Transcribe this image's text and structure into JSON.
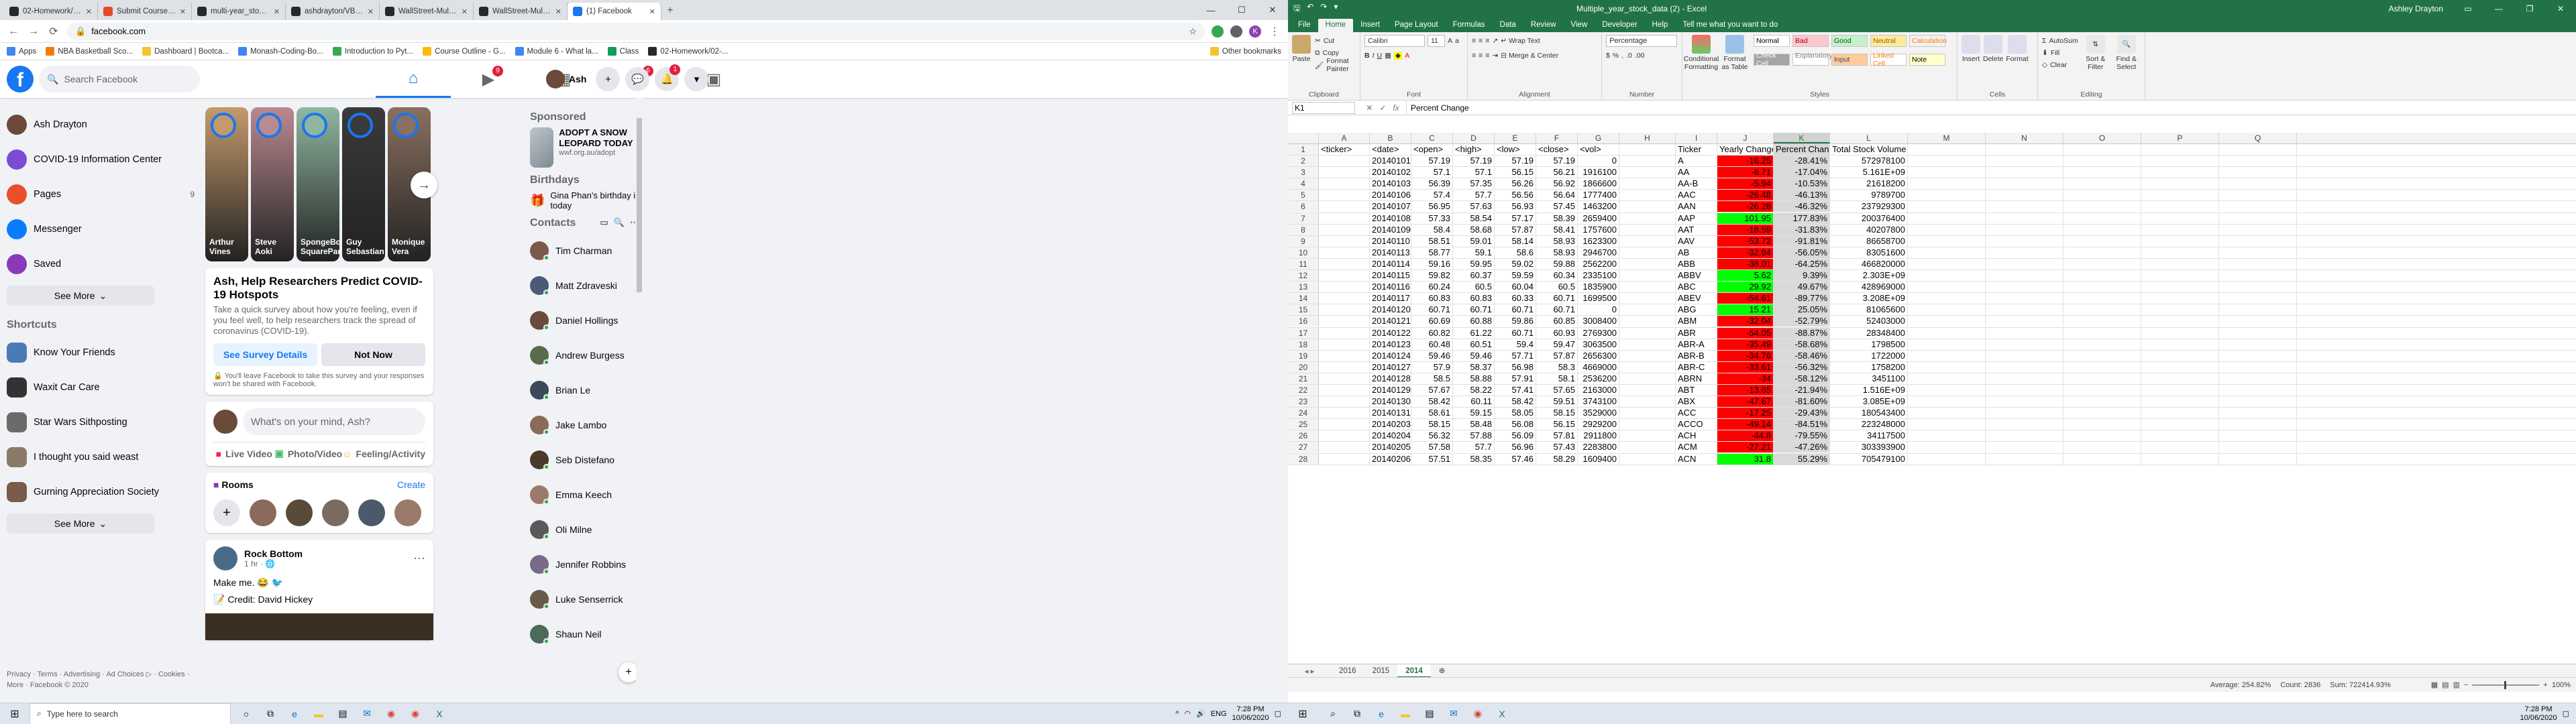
{
  "chrome": {
    "tabs": [
      {
        "title": "02-Homework/02-VBA-Scriptin...",
        "color": "#24292e"
      },
      {
        "title": "Submit Coursework | Bootcam...",
        "color": "#e34c26"
      },
      {
        "title": "multi-year_stock_data/Multi-Yr...",
        "color": "#24292e"
      },
      {
        "title": "ashdrayton/VBA-challenge",
        "color": "#24292e"
      },
      {
        "title": "WallStreet-Multi-Year-Data-VBA...",
        "color": "#24292e"
      },
      {
        "title": "WallStreet-Multi-Year-Data-VBA...",
        "color": "#24292e"
      },
      {
        "title": "(1) Facebook",
        "color": "#1877f2"
      }
    ],
    "url": "facebook.com",
    "bookmarks": [
      "Apps",
      "NBA Basketball Sco...",
      "Dashboard | Bootca...",
      "Monash-Coding-Bo...",
      "Introduction to Pyt...",
      "Course Outline - G...",
      "Module 6 - What la...",
      "Class",
      "02-Homework/02-..."
    ],
    "other_bookmarks": "Other bookmarks"
  },
  "facebook": {
    "search_placeholder": "Search Facebook",
    "nav_badges": {
      "watch": "9",
      "groups": "6"
    },
    "user_short": "Ash",
    "notif_badge": "1",
    "left_items": [
      {
        "label": "Ash Drayton",
        "icon": "profile-avatar",
        "color": "#6b4a3a"
      },
      {
        "label": "COVID-19 Information Center",
        "icon": "covid-icon",
        "color": "#7b4bd6"
      },
      {
        "label": "Pages",
        "icon": "flag-icon",
        "color": "#e8502a",
        "count": "9"
      },
      {
        "label": "Messenger",
        "icon": "messenger-icon",
        "color": "#0a7cff"
      },
      {
        "label": "Saved",
        "icon": "bookmark-icon",
        "color": "#8a3ab9"
      }
    ],
    "see_more": "See More",
    "shortcuts_title": "Shortcuts",
    "shortcuts": [
      {
        "label": "Know Your Friends",
        "color": "#4a7bb7"
      },
      {
        "label": "Waxit Car Care",
        "color": "#333333"
      },
      {
        "label": "Star Wars Sithposting",
        "color": "#6b6b6b"
      },
      {
        "label": "I thought you said weast",
        "color": "#8a7a6a"
      },
      {
        "label": "Gurning Appreciation Society",
        "color": "#7a5a4a"
      }
    ],
    "footer": "Privacy · Terms · Advertising · Ad Choices ▷ · Cookies · More · Facebook © 2020",
    "stories": [
      {
        "name": "Arthur Vines",
        "color": "#c49a6c"
      },
      {
        "name": "Steve Aoki",
        "color": "#b98a90"
      },
      {
        "name": "SpongeBob SquarePants",
        "color": "#8fb7a0"
      },
      {
        "name": "Guy Sebastian",
        "color": "#3a3a3a"
      },
      {
        "name": "Monique Vera",
        "color": "#8a7060"
      }
    ],
    "survey": {
      "title": "Ash, Help Researchers Predict COVID-19 Hotspots",
      "body": "Take a quick survey about how you're feeling, even if you feel well, to help researchers track the spread of coronavirus (COVID-19).",
      "details": "See Survey Details",
      "not_now": "Not Now",
      "notice": "You'll leave Facebook to take this survey and your responses won't be shared with Facebook."
    },
    "composer": {
      "placeholder": "What's on your mind, Ash?",
      "live": "Live Video",
      "photo": "Photo/Video",
      "feeling": "Feeling/Activity"
    },
    "rooms": {
      "title": "Rooms",
      "create": "Create"
    },
    "post": {
      "author": "Rock Bottom",
      "meta": "1 hr · 🌐",
      "text": "Make me. 😂 🐦",
      "credit": "📝 Credit: David Hickey"
    },
    "sponsored_title": "Sponsored",
    "ad": {
      "title": "ADOPT A SNOW LEOPARD TODAY",
      "url": "wwf.org.au/adopt"
    },
    "birthdays_title": "Birthdays",
    "birthday_text": "Gina Phan's birthday is today",
    "contacts_title": "Contacts",
    "contacts": [
      "Tim Charman",
      "Matt Zdraveski",
      "Daniel Hollings",
      "Andrew Burgess",
      "Brian Le",
      "Jake Lambo",
      "Seb Distefano",
      "Emma Keech",
      "Oli Milne",
      "Jennifer Robbins",
      "Luke Senserrick",
      "Shaun Neil"
    ]
  },
  "taskbar": {
    "search_placeholder": "Type here to search",
    "time": "7:28 PM",
    "date": "10/06/2020",
    "lang": "ENG"
  },
  "excel": {
    "title": "Multiple_year_stock_data (2) - Excel",
    "user": "Ashley Drayton",
    "tabs": [
      "File",
      "Home",
      "Insert",
      "Page Layout",
      "Formulas",
      "Data",
      "Review",
      "View",
      "Developer",
      "Help",
      "Tell me what you want to do"
    ],
    "font": "Calibri",
    "font_size": "11",
    "number_format": "Percentage",
    "styles": [
      {
        "label": "Normal",
        "bg": "#ffffff",
        "fg": "#000000"
      },
      {
        "label": "Bad",
        "bg": "#ffc7ce",
        "fg": "#9c0006"
      },
      {
        "label": "Good",
        "bg": "#c6efce",
        "fg": "#006100"
      },
      {
        "label": "Neutral",
        "bg": "#ffeb9c",
        "fg": "#9c5700"
      },
      {
        "label": "Calculation",
        "bg": "#f2f2f2",
        "fg": "#fa7d00"
      },
      {
        "label": "Check Cell",
        "bg": "#a5a5a5",
        "fg": "#ffffff"
      },
      {
        "label": "Explanatory ...",
        "bg": "#ffffff",
        "fg": "#7f7f7f"
      },
      {
        "label": "Input",
        "bg": "#ffcc99",
        "fg": "#3f3f76"
      },
      {
        "label": "Linked Cell",
        "bg": "#ffffff",
        "fg": "#fa7d00"
      },
      {
        "label": "Note",
        "bg": "#ffffcc",
        "fg": "#000000"
      }
    ],
    "ribbon_labels": {
      "paste": "Paste",
      "cut": "Cut",
      "copy": "Copy",
      "format_painter": "Format Painter",
      "clipboard": "Clipboard",
      "font_group": "Font",
      "wrap": "Wrap Text",
      "merge": "Merge & Center",
      "alignment": "Alignment",
      "number": "Number",
      "cond": "Conditional Formatting",
      "format_table": "Format as Table",
      "styles_group": "Styles",
      "insert": "Insert",
      "delete": "Delete",
      "format": "Format",
      "cells": "Cells",
      "autosum": "AutoSum",
      "fill": "Fill",
      "clear": "Clear",
      "sort": "Sort & Filter",
      "find": "Find & Select",
      "editing": "Editing"
    },
    "name_box": "K1",
    "formula": "Percent Change",
    "columns": [
      "A",
      "B",
      "C",
      "D",
      "E",
      "F",
      "G",
      "H",
      "I",
      "J",
      "K",
      "L",
      "M",
      "N",
      "O",
      "P",
      "Q"
    ],
    "headers": [
      "<ticker>",
      "<date>",
      "<open>",
      "<high>",
      "<low>",
      "<close>",
      "<vol>",
      "",
      "Ticker",
      "Yearly Change",
      "Percent Change",
      "Total Stock Volume"
    ],
    "rows": [
      [
        "20140101",
        "57.19",
        "57.19",
        "57.19",
        "57.19",
        "0",
        "A",
        "-16.25",
        "-28.41%",
        "572978100",
        "red"
      ],
      [
        "20140102",
        "57.1",
        "57.1",
        "56.15",
        "56.21",
        "1916100",
        "AA",
        "-8.71",
        "-17.04%",
        "5.161E+09",
        "red"
      ],
      [
        "20140103",
        "56.39",
        "57.35",
        "56.26",
        "56.92",
        "1866600",
        "AA-B",
        "-5.94",
        "-10.53%",
        "21618200",
        "red"
      ],
      [
        "20140106",
        "57.4",
        "57.7",
        "56.56",
        "56.64",
        "1777400",
        "AAC",
        "-26.48",
        "-46.13%",
        "9789700",
        "red"
      ],
      [
        "20140107",
        "56.95",
        "57.63",
        "56.93",
        "57.45",
        "1463200",
        "AAN",
        "-26.28",
        "-46.32%",
        "237929300",
        "red"
      ],
      [
        "20140108",
        "57.33",
        "58.54",
        "57.17",
        "58.39",
        "2659400",
        "AAP",
        "101.95",
        "177.83%",
        "200376400",
        "green"
      ],
      [
        "20140109",
        "58.4",
        "58.68",
        "57.87",
        "58.41",
        "1757600",
        "AAT",
        "-18.59",
        "-31.83%",
        "40207800",
        "red"
      ],
      [
        "20140110",
        "58.51",
        "59.01",
        "58.14",
        "58.93",
        "1623300",
        "AAV",
        "-53.72",
        "-91.81%",
        "86658700",
        "red"
      ],
      [
        "20140113",
        "58.77",
        "59.1",
        "58.6",
        "58.93",
        "2946700",
        "AB",
        "-32.94",
        "-56.05%",
        "83051600",
        "red"
      ],
      [
        "20140114",
        "59.16",
        "59.95",
        "59.02",
        "59.88",
        "2562200",
        "ABB",
        "-38.01",
        "-64.25%",
        "466820000",
        "red"
      ],
      [
        "20140115",
        "59.82",
        "60.37",
        "59.59",
        "60.34",
        "2335100",
        "ABBV",
        "5.62",
        "9.39%",
        "2.303E+09",
        "green"
      ],
      [
        "20140116",
        "60.24",
        "60.5",
        "60.04",
        "60.5",
        "1835900",
        "ABC",
        "29.92",
        "49.67%",
        "428969000",
        "green"
      ],
      [
        "20140117",
        "60.83",
        "60.83",
        "60.33",
        "60.71",
        "1699500",
        "ABEV",
        "-54.61",
        "-89.77%",
        "3.208E+09",
        "red"
      ],
      [
        "20140120",
        "60.71",
        "60.71",
        "60.71",
        "60.71",
        "0",
        "ABG",
        "15.21",
        "25.05%",
        "81065600",
        "green"
      ],
      [
        "20140121",
        "60.69",
        "60.88",
        "59.86",
        "60.85",
        "3008400",
        "ABM",
        "-32.04",
        "-52.79%",
        "52403000",
        "red"
      ],
      [
        "20140122",
        "60.82",
        "61.22",
        "60.71",
        "60.93",
        "2769300",
        "ABR",
        "-54.05",
        "-88.87%",
        "28348400",
        "red"
      ],
      [
        "20140123",
        "60.48",
        "60.51",
        "59.4",
        "59.47",
        "3063500",
        "ABR-A",
        "-35.49",
        "-58.68%",
        "1798500",
        "red"
      ],
      [
        "20140124",
        "59.46",
        "59.46",
        "57.71",
        "57.87",
        "2656300",
        "ABR-B",
        "-34.76",
        "-58.46%",
        "1722000",
        "red"
      ],
      [
        "20140127",
        "57.9",
        "58.37",
        "56.98",
        "58.3",
        "4669000",
        "ABR-C",
        "-33.61",
        "-56.32%",
        "1758200",
        "red"
      ],
      [
        "20140128",
        "58.5",
        "58.88",
        "57.91",
        "58.1",
        "2536200",
        "ABRN",
        "-34",
        "-58.12%",
        "3451100",
        "red"
      ],
      [
        "20140129",
        "57.67",
        "58.22",
        "57.41",
        "57.65",
        "2163000",
        "ABT",
        "-13.65",
        "-21.94%",
        "1.516E+09",
        "red"
      ],
      [
        "20140130",
        "58.42",
        "60.11",
        "58.42",
        "59.51",
        "3743100",
        "ABX",
        "-47.67",
        "-81.60%",
        "3.085E+09",
        "red"
      ],
      [
        "20140131",
        "58.61",
        "59.15",
        "58.05",
        "58.15",
        "3529000",
        "ACC",
        "-17.25",
        "-29.43%",
        "180543400",
        "red"
      ],
      [
        "20140203",
        "58.15",
        "58.48",
        "56.08",
        "56.15",
        "2929200",
        "ACCO",
        "-49.14",
        "-84.51%",
        "223248000",
        "red"
      ],
      [
        "20140204",
        "56.32",
        "57.88",
        "56.09",
        "57.81",
        "2911800",
        "ACH",
        "-44.8",
        "-79.55%",
        "34117500",
        "red"
      ],
      [
        "20140205",
        "57.58",
        "57.7",
        "56.96",
        "57.43",
        "2283800",
        "ACM",
        "-27.21",
        "-47.26%",
        "303393900",
        "red"
      ],
      [
        "20140206",
        "57.51",
        "58.35",
        "57.46",
        "58.29",
        "1609400",
        "ACN",
        "31.8",
        "55.29%",
        "705479100",
        "green"
      ]
    ],
    "sheets": [
      "2016",
      "2015",
      "2014"
    ],
    "active_sheet": "2014",
    "status": {
      "average": "Average: 254.82%",
      "count": "Count: 2836",
      "sum": "Sum: 722414.93%",
      "zoom": "100%"
    }
  }
}
